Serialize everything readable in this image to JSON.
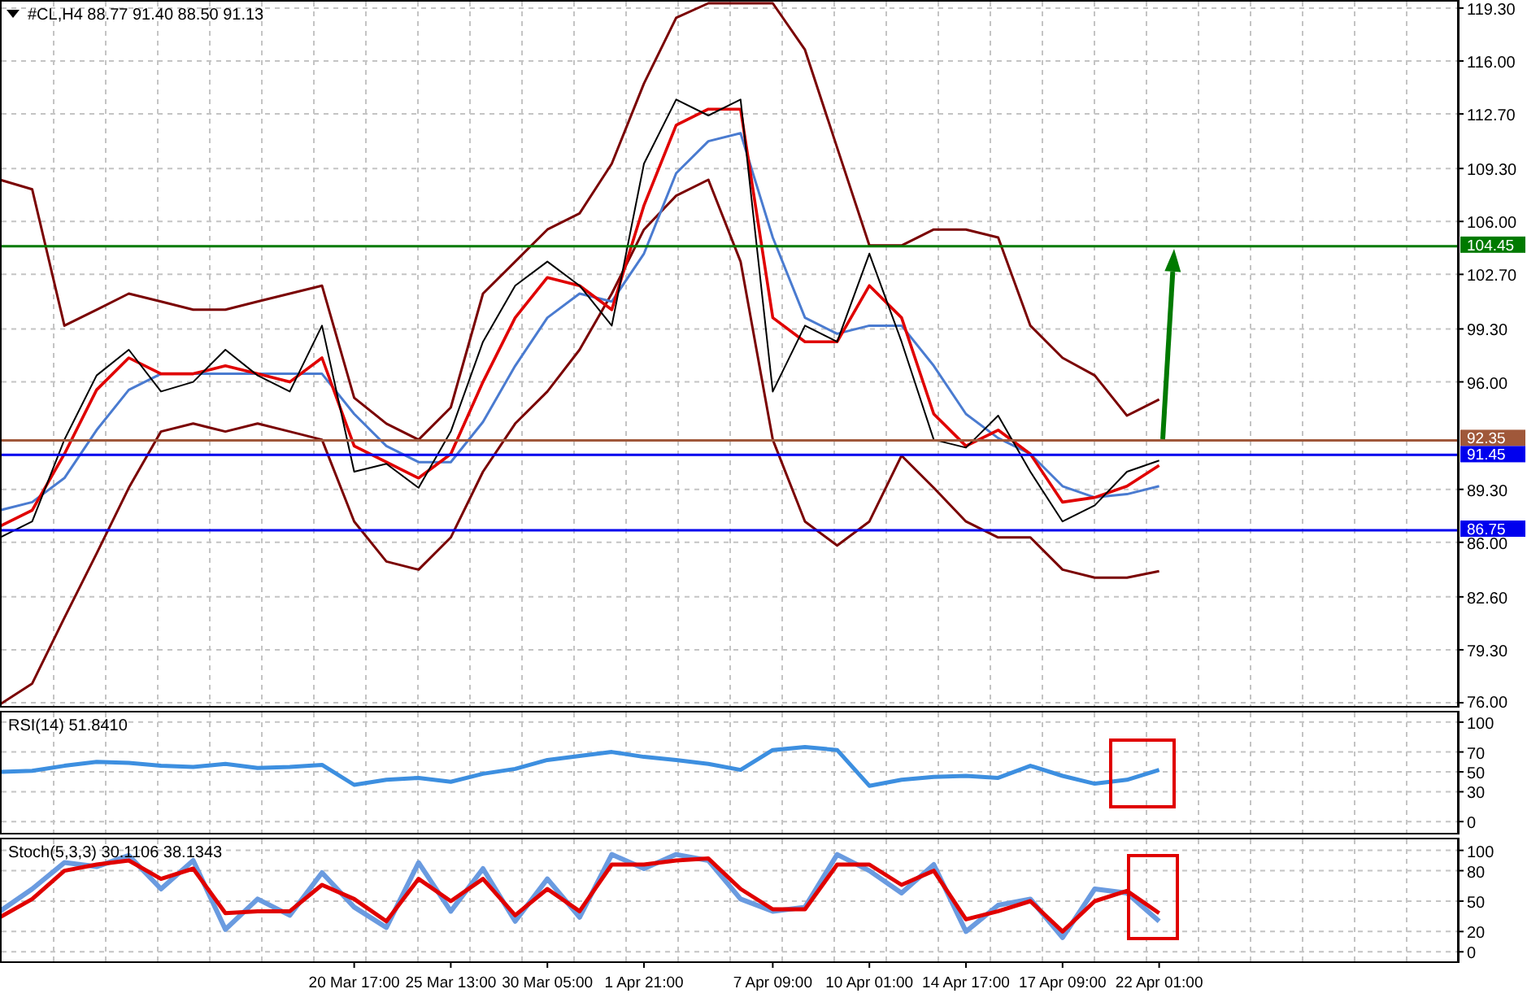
{
  "main_panel": {
    "chart_data": {
      "type": "line",
      "title": "#CL,H4 88.77 91.40 88.50 91.13",
      "grid": true,
      "ylim": [
        75.8,
        119.7
      ],
      "yticks": [
        {
          "value": 119.3,
          "label": "119.30"
        },
        {
          "value": 116,
          "label": "116.00"
        },
        {
          "value": 112.7,
          "label": "112.70"
        },
        {
          "value": 109.3,
          "label": "109.30"
        },
        {
          "value": 106,
          "label": "106.00"
        },
        {
          "value": 102.7,
          "label": "102.70"
        },
        {
          "value": 99.3,
          "label": "99.30"
        },
        {
          "value": 96,
          "label": "96.00"
        },
        {
          "value": 89.3,
          "label": "89.30"
        },
        {
          "value": 86,
          "label": "86.00"
        },
        {
          "value": 82.6,
          "label": "82.60"
        },
        {
          "value": 79.3,
          "label": "79.30"
        },
        {
          "value": 76,
          "label": "76.00"
        }
      ],
      "series": [
        {
          "color": "#7a0000",
          "values": [
            108.6,
            108,
            99.5,
            100.5,
            101.5,
            101,
            100.5,
            100.5,
            101,
            101.5,
            102,
            95,
            93.4,
            92.4,
            94.4,
            101.5,
            103.5,
            105.5,
            106.5,
            109.6,
            114.6,
            118.7,
            119.6,
            119.6,
            119.6,
            116.7,
            110.6,
            104.5,
            104.5,
            105.5,
            105.5,
            105,
            99.5,
            97.5,
            96.4,
            93.9,
            94.9
          ]
        },
        {
          "color": "#7a0000",
          "values": [
            75.9,
            77.2,
            81.3,
            85.3,
            89.4,
            92.9,
            93.4,
            92.9,
            93.4,
            92.9,
            92.4,
            87.3,
            84.8,
            84.3,
            86.3,
            90.4,
            93.4,
            95.4,
            98,
            101.5,
            105.5,
            107.6,
            108.6,
            103.5,
            92.4,
            87.3,
            85.8,
            87.3,
            91.4,
            89.4,
            87.3,
            86.3,
            86.3,
            84.3,
            83.8,
            83.8,
            84.2
          ]
        },
        {
          "color": "#4a7bd0",
          "values": [
            88,
            88.5,
            90,
            93,
            95.5,
            96.5,
            96.5,
            96.5,
            96.5,
            96.5,
            96.5,
            94,
            92,
            91,
            91,
            93.5,
            97,
            100,
            101.5,
            101,
            104,
            109,
            111,
            111.5,
            105,
            100,
            99,
            99.5,
            99.5,
            97,
            94,
            92.5,
            91.5,
            89.5,
            88.8,
            89,
            89.5
          ]
        },
        {
          "color": "#e00000",
          "values": [
            87,
            88,
            91.5,
            95.5,
            97.5,
            96.5,
            96.5,
            97,
            96.5,
            96,
            97.5,
            92,
            91,
            90,
            91.5,
            96,
            100,
            102.5,
            102,
            100.5,
            107,
            112,
            113,
            113,
            100,
            98.5,
            98.5,
            102,
            100,
            94,
            92,
            93,
            91.5,
            88.5,
            88.8,
            89.5,
            90.8
          ]
        },
        {
          "color": "#000000",
          "values": [
            86.3,
            87.3,
            92.4,
            96.4,
            98,
            95.4,
            96,
            98,
            96.4,
            95.4,
            99.5,
            90.4,
            90.9,
            89.4,
            92.9,
            98.5,
            102,
            103.5,
            102,
            99.5,
            109.6,
            113.6,
            112.6,
            113.6,
            95.4,
            99.5,
            98.5,
            104,
            98.5,
            92.4,
            91.9,
            93.9,
            90.4,
            87.3,
            88.3,
            90.4,
            91.1
          ]
        }
      ],
      "ref_lines": [
        {
          "axis": "y",
          "value": 104.45,
          "color": "#007a00",
          "label": "104.45"
        },
        {
          "axis": "y",
          "value": 92.35,
          "color": "#a0583a",
          "label": "92.35"
        },
        {
          "axis": "y",
          "value": 91.45,
          "color": "#0000ee",
          "label": "91.45"
        },
        {
          "axis": "y",
          "value": 86.75,
          "color": "#0000ee",
          "label": "86.75"
        }
      ]
    }
  },
  "rsi_panel": {
    "chart_data": {
      "type": "line",
      "title": "RSI(14) 51.8410",
      "grid": true,
      "ylim": [
        -11.3,
        109.7
      ],
      "yticks": [
        100,
        70,
        50,
        30,
        0
      ],
      "series": [
        {
          "color": "#3d8fe0",
          "values": [
            50,
            51,
            56,
            60,
            59,
            56,
            55,
            58,
            54,
            55,
            57,
            37,
            42,
            44,
            40,
            48,
            53,
            62,
            66,
            70,
            65,
            62,
            58,
            52,
            72,
            75,
            72,
            36,
            42,
            45,
            46,
            44,
            56,
            46,
            38,
            42,
            52
          ]
        }
      ]
    }
  },
  "stoch_panel": {
    "chart_data": {
      "type": "line",
      "title": "Stoch(5,3,3) 30.1106 38.1343",
      "grid": true,
      "ylim": [
        -9.4,
        110.9
      ],
      "yticks": [
        100,
        80,
        50,
        20,
        0
      ],
      "categories": [
        null,
        null,
        null,
        null,
        null,
        null,
        null,
        null,
        null,
        null,
        null,
        "20 Mar 17:00",
        null,
        null,
        "25 Mar 13:00",
        null,
        null,
        "30 Mar 05:00",
        null,
        null,
        "1 Apr 21:00",
        null,
        null,
        null,
        "7 Apr 09:00",
        null,
        null,
        "10 Apr 01:00",
        null,
        null,
        "14 Apr 17:00",
        null,
        null,
        "17 Apr 09:00",
        null,
        null,
        "22 Apr 01:00"
      ],
      "series": [
        {
          "color": "#6a9be0",
          "values": [
            40,
            62,
            88,
            84,
            95,
            62,
            90,
            22,
            52,
            36,
            78,
            44,
            24,
            88,
            40,
            82,
            30,
            72,
            34,
            96,
            82,
            96,
            90,
            52,
            40,
            44,
            96,
            80,
            58,
            86,
            20,
            46,
            52,
            14,
            62,
            58,
            30
          ]
        },
        {
          "color": "#e00000",
          "values": [
            34,
            52,
            80,
            86,
            90,
            72,
            82,
            38,
            40,
            40,
            66,
            52,
            30,
            72,
            50,
            72,
            36,
            62,
            40,
            86,
            86,
            90,
            92,
            62,
            42,
            42,
            86,
            86,
            66,
            80,
            32,
            40,
            50,
            20,
            50,
            60,
            38
          ]
        }
      ]
    }
  }
}
